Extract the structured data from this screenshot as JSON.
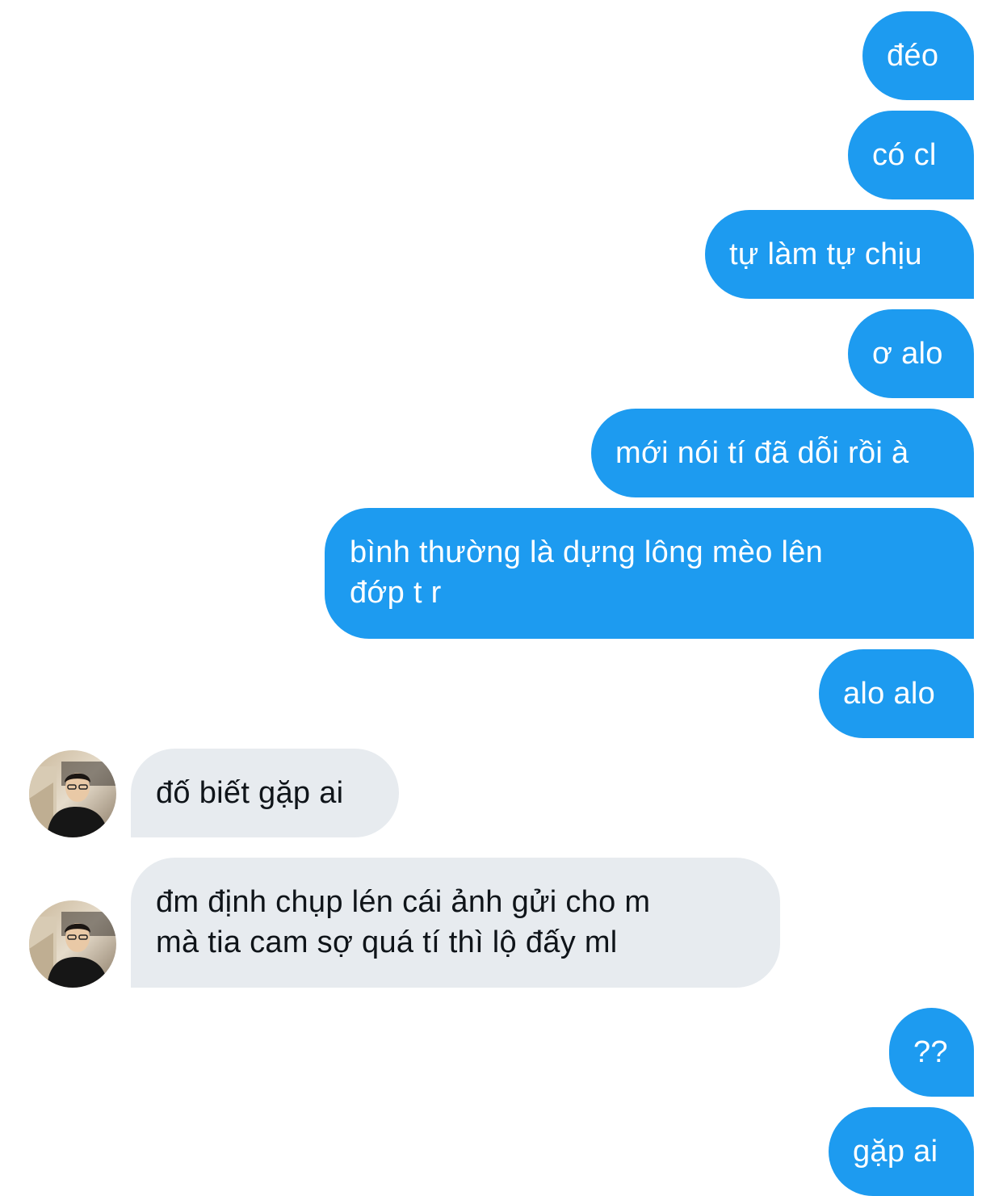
{
  "messages": [
    {
      "direction": "out",
      "text": "đéo"
    },
    {
      "direction": "out",
      "text": "có cl"
    },
    {
      "direction": "out",
      "text": "tự làm tự chịu"
    },
    {
      "direction": "out",
      "text": "ơ alo"
    },
    {
      "direction": "out",
      "text": "mới nói tí đã dỗi rồi à"
    },
    {
      "direction": "out",
      "text": "bình thường là dựng lông mèo lên\nđớp t r"
    },
    {
      "direction": "out",
      "text": "alo alo"
    },
    {
      "direction": "in",
      "text": "đố biết gặp ai"
    },
    {
      "direction": "in",
      "text": "đm định chụp lén cái ảnh gửi cho m\nmà tia cam sợ quá tí thì lộ đấy ml"
    },
    {
      "direction": "out",
      "text": "??"
    },
    {
      "direction": "out",
      "text": "gặp ai"
    }
  ],
  "colors": {
    "outgoing_bubble": "#1d9bf0",
    "incoming_bubble": "#e7ebef",
    "outgoing_text": "#ffffff",
    "incoming_text": "#0f1419"
  },
  "avatar": {
    "icon": "user-photo-avatar"
  }
}
